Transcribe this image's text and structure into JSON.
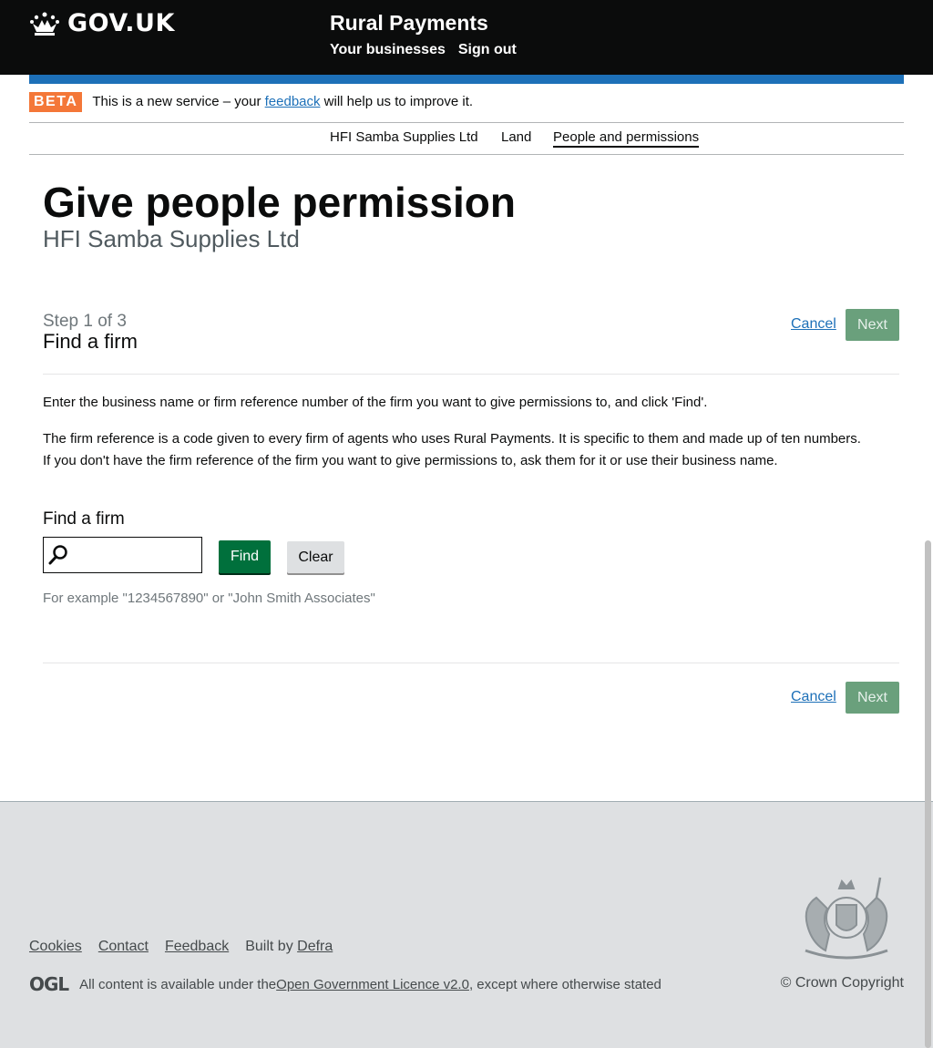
{
  "header": {
    "logo_text": "GOV.UK",
    "service_name": "Rural Payments",
    "nav": [
      "Your businesses",
      "Sign out"
    ]
  },
  "beta": {
    "tag": "BETA",
    "text_before": "This is a new service – your ",
    "link": "feedback",
    "text_after": " will help us to improve it."
  },
  "subnav": {
    "items": [
      "HFI Samba Supplies Ltd",
      "Land",
      "People and permissions"
    ],
    "active": "People and permissions"
  },
  "page": {
    "title": "Give people permission",
    "caption": "HFI Samba Supplies Ltd"
  },
  "step": {
    "label": "Step 1 of 3",
    "title": "Find a firm",
    "cancel": "Cancel",
    "next": "Next"
  },
  "content": {
    "para1": "Enter the business name or firm reference number of the firm you want to give permissions to, and click 'Find'.",
    "para2_line1": "The firm reference is a code given to every firm of agents who uses Rural Payments. It is specific to them and made up of ten numbers.",
    "para2_line2": "If you don't have the firm reference of the firm you want to give permissions to, ask them for it or use their business name."
  },
  "search": {
    "label": "Find a firm",
    "value": "",
    "find_label": "Find",
    "clear_label": "Clear",
    "hint": "For example \"1234567890\" or \"John Smith Associates\""
  },
  "footer": {
    "links": [
      "Cookies",
      "Contact",
      "Feedback"
    ],
    "built_by": "Built by ",
    "built_by_link": "Defra",
    "ogl_logo": "OGL",
    "licence_before": "All content is available under the ",
    "licence_link": "Open Government Licence v2.0",
    "licence_after": ", except where otherwise stated",
    "copyright": "© Crown Copyright"
  },
  "colors": {
    "header_bg": "#0b0c0c",
    "accent_blue": "#1d70b8",
    "beta_orange": "#f47738",
    "find_green": "#00703c",
    "next_green": "#6aa07c",
    "footer_bg": "#dee0e2"
  }
}
